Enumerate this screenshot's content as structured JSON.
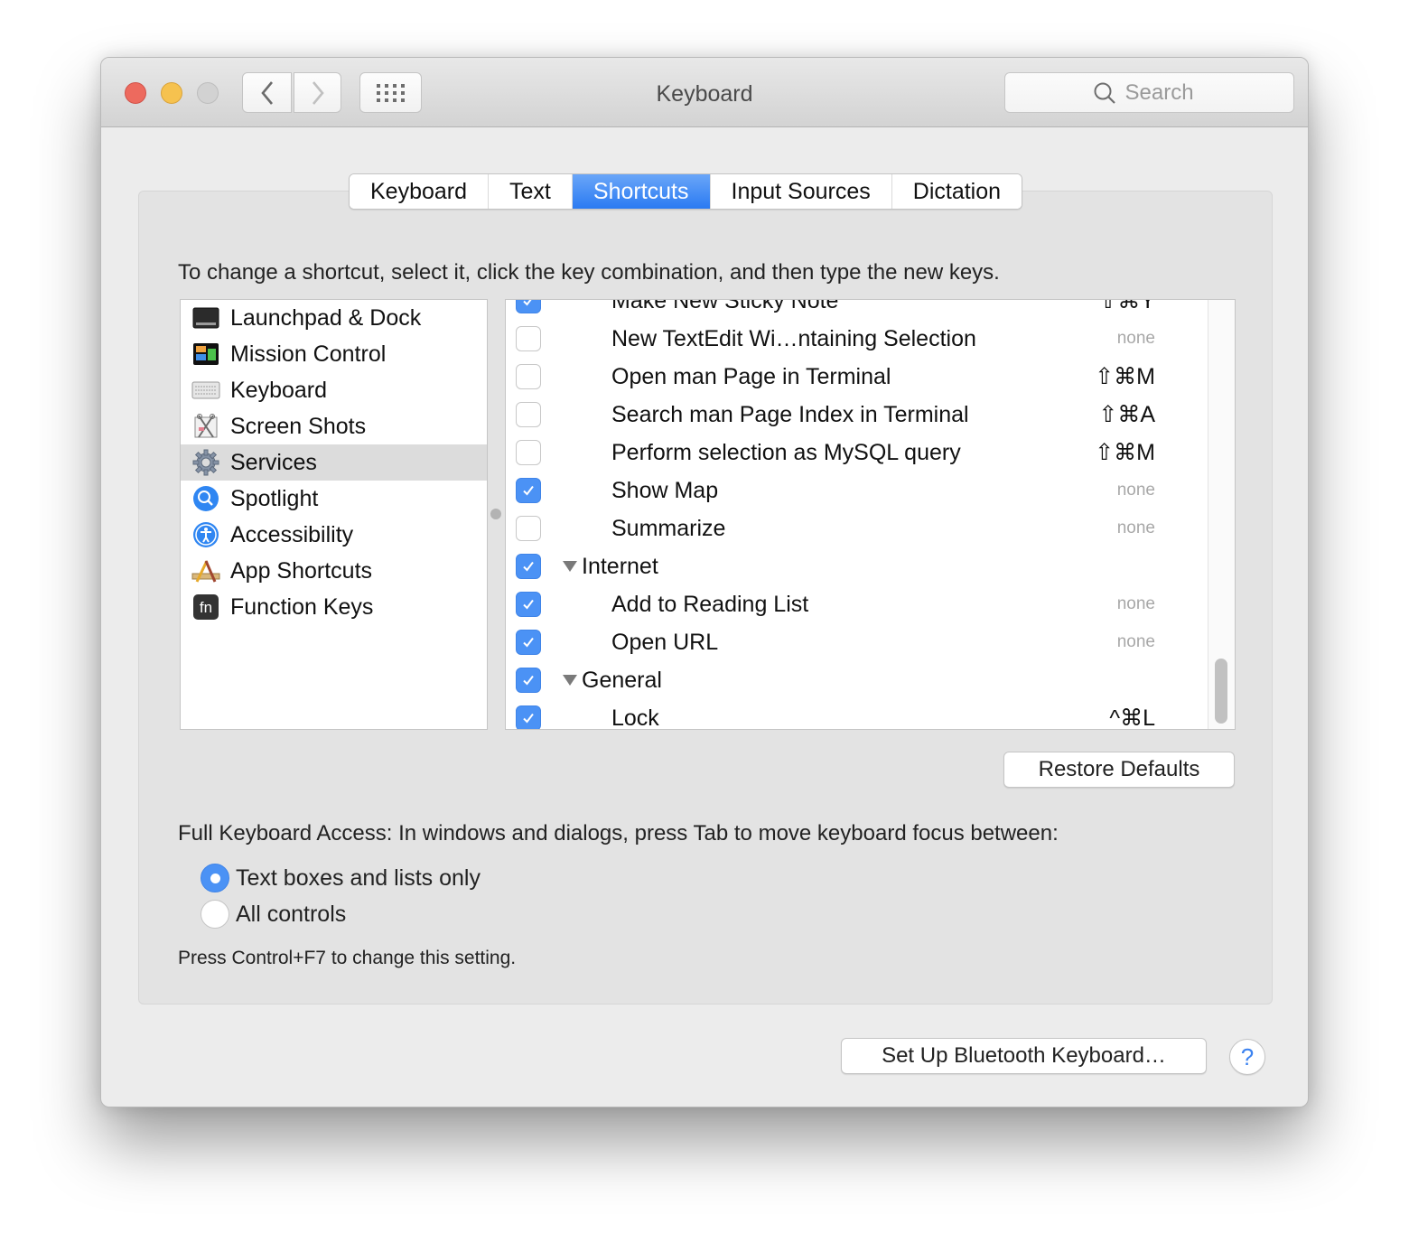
{
  "window": {
    "title": "Keyboard",
    "search_placeholder": "Search"
  },
  "tabs": [
    {
      "label": "Keyboard",
      "active": false
    },
    {
      "label": "Text",
      "active": false
    },
    {
      "label": "Shortcuts",
      "active": true
    },
    {
      "label": "Input Sources",
      "active": false
    },
    {
      "label": "Dictation",
      "active": false
    }
  ],
  "instructions": "To change a shortcut, select it, click the key combination, and then type the new keys.",
  "categories": [
    {
      "label": "Launchpad & Dock",
      "icon": "launchpad-dock-icon",
      "selected": false
    },
    {
      "label": "Mission Control",
      "icon": "mission-control-icon",
      "selected": false
    },
    {
      "label": "Keyboard",
      "icon": "keyboard-icon",
      "selected": false
    },
    {
      "label": "Screen Shots",
      "icon": "screenshot-icon",
      "selected": false
    },
    {
      "label": "Services",
      "icon": "gear-icon",
      "selected": true
    },
    {
      "label": "Spotlight",
      "icon": "spotlight-icon",
      "selected": false
    },
    {
      "label": "Accessibility",
      "icon": "accessibility-icon",
      "selected": false
    },
    {
      "label": "App Shortcuts",
      "icon": "app-shortcuts-icon",
      "selected": false
    },
    {
      "label": "Function Keys",
      "icon": "function-keys-icon",
      "selected": false
    }
  ],
  "shortcuts": [
    {
      "label": "Make New Sticky Note",
      "key": "⇧⌘Y",
      "checked": true,
      "group": false,
      "partial": true
    },
    {
      "label": "New TextEdit Wi…ntaining Selection",
      "key": "none",
      "checked": false,
      "group": false
    },
    {
      "label": "Open man Page in Terminal",
      "key": "⇧⌘M",
      "checked": false,
      "group": false
    },
    {
      "label": "Search man Page Index in Terminal",
      "key": "⇧⌘A",
      "checked": false,
      "group": false
    },
    {
      "label": "Perform selection as MySQL query",
      "key": "⇧⌘M",
      "checked": false,
      "group": false
    },
    {
      "label": "Show Map",
      "key": "none",
      "checked": true,
      "group": false
    },
    {
      "label": "Summarize",
      "key": "none",
      "checked": false,
      "group": false
    },
    {
      "label": "Internet",
      "key": "",
      "checked": true,
      "group": true
    },
    {
      "label": "Add to Reading List",
      "key": "none",
      "checked": true,
      "group": false
    },
    {
      "label": "Open URL",
      "key": "none",
      "checked": true,
      "group": false
    },
    {
      "label": "General",
      "key": "",
      "checked": true,
      "group": true
    },
    {
      "label": "Lock",
      "key": "^⌘L",
      "checked": true,
      "group": false
    }
  ],
  "buttons": {
    "restore_defaults": "Restore Defaults",
    "bluetooth": "Set Up Bluetooth Keyboard…",
    "help": "?"
  },
  "full_keyboard_access": {
    "label": "Full Keyboard Access: In windows and dialogs, press Tab to move keyboard focus between:",
    "options": [
      {
        "label": "Text boxes and lists only",
        "selected": true
      },
      {
        "label": "All controls",
        "selected": false
      }
    ],
    "note": "Press Control+F7 to change this setting."
  },
  "colors": {
    "accent": "#4b92f5",
    "close": "#ed6a5e",
    "minimize": "#f6c24f",
    "zoom_disabled": "#d2d2d2"
  }
}
